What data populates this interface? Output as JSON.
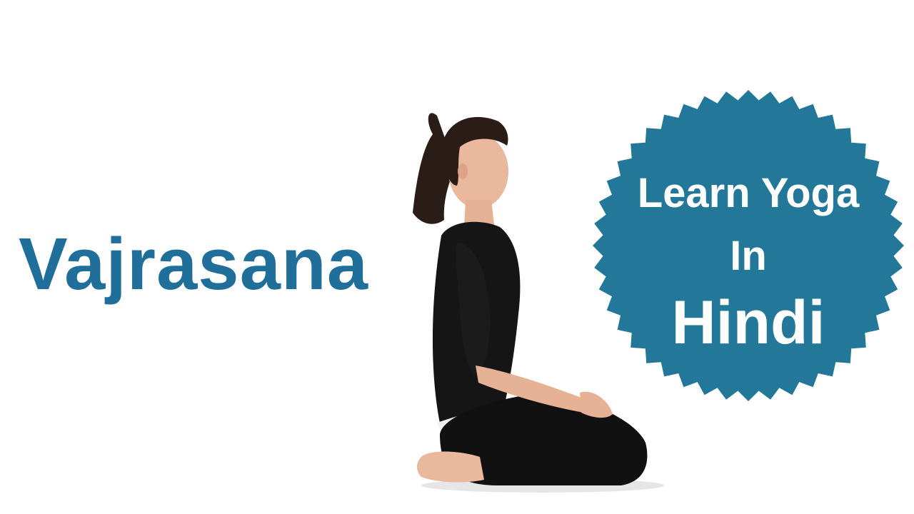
{
  "heading": "Vajrasana",
  "badge": {
    "line1": "Learn Yoga",
    "line2": "In",
    "line3": "Hindi"
  },
  "colors": {
    "heading": "#1f6f9a",
    "badge_fill": "#237799",
    "badge_text": "#ffffff",
    "outfit": "#111111",
    "skin": "#e9b89d"
  },
  "photo": {
    "subject": "woman-seated-kneeling-vajrasana"
  }
}
